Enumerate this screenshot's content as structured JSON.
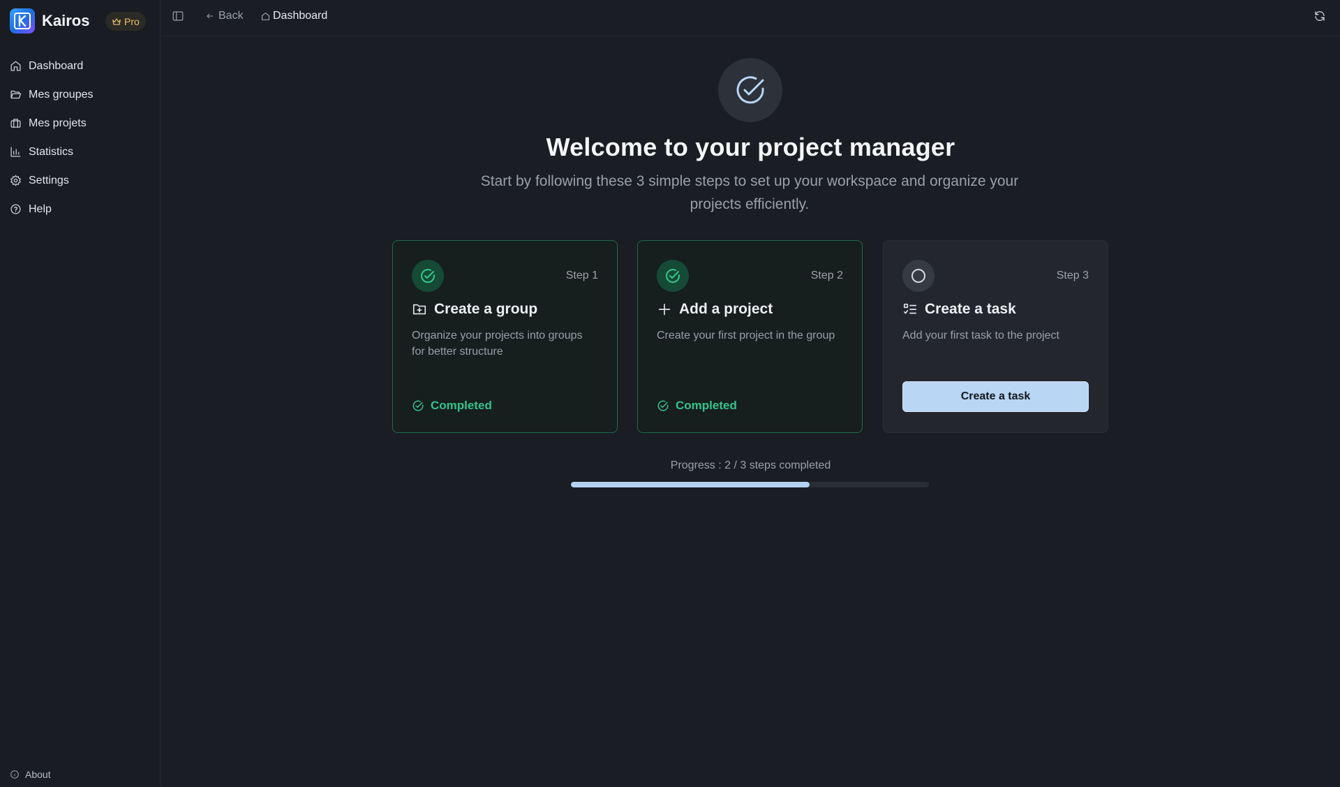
{
  "app": {
    "name": "Kairos",
    "badge": "Pro"
  },
  "sidebar": {
    "items": [
      {
        "label": "Dashboard",
        "icon": "home-icon"
      },
      {
        "label": "Mes groupes",
        "icon": "folder-open-icon"
      },
      {
        "label": "Mes projets",
        "icon": "briefcase-icon"
      },
      {
        "label": "Statistics",
        "icon": "bar-chart-icon"
      },
      {
        "label": "Settings",
        "icon": "gear-icon"
      },
      {
        "label": "Help",
        "icon": "help-circle-icon"
      }
    ],
    "footer": {
      "label": "About",
      "icon": "info-icon"
    }
  },
  "topbar": {
    "back_label": "Back",
    "breadcrumb": "Dashboard"
  },
  "hero": {
    "title": "Welcome to your project manager",
    "subtitle": "Start by following these 3 simple steps to set up your workspace and organize your projects efficiently."
  },
  "steps": [
    {
      "step": "Step 1",
      "title": "Create a group",
      "description": "Organize your projects into groups for better structure",
      "status": "Completed"
    },
    {
      "step": "Step 2",
      "title": "Add a project",
      "description": "Create your first project in the group",
      "status": "Completed"
    },
    {
      "step": "Step 3",
      "title": "Create a task",
      "description": "Add your first task to the project",
      "button": "Create a task"
    }
  ],
  "progress": {
    "label": "Progress : 2 / 3 steps completed",
    "completed": 2,
    "total": 3
  },
  "colors": {
    "accent": "#b9d6f4",
    "success": "#33c48b",
    "background": "#1a1d23"
  }
}
